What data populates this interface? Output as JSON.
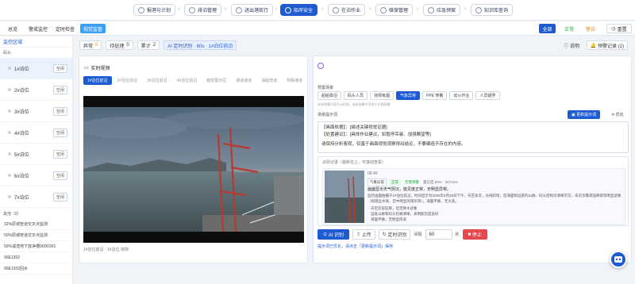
{
  "top_nav": {
    "items": [
      {
        "label": "报港与计划",
        "icon": "document-icon"
      },
      {
        "label": "排泊管理",
        "icon": "anchor-icon"
      },
      {
        "label": "进出港航行",
        "icon": "compass-icon"
      },
      {
        "label": "船岸安全",
        "icon": "shield-icon"
      },
      {
        "label": "在泊作业",
        "icon": "wrench-icon"
      },
      {
        "label": "维保管理",
        "icon": "gear-icon"
      },
      {
        "label": "应急预案",
        "icon": "alert-icon"
      },
      {
        "label": "知识库查询",
        "icon": "book-icon"
      }
    ]
  },
  "sub_nav": {
    "tabs": [
      "总览",
      "警戒监控",
      "定时检查",
      "视觉监管"
    ]
  },
  "filters": {
    "all": "全部",
    "normal": "正常",
    "warning": "警告",
    "reset": "重置"
  },
  "colors": {
    "primary": "#1c5bd1",
    "ok": "#2aa84a",
    "warn": "#e8912a",
    "danger": "#e5484d",
    "ai_chip_bg": "#e9f0ff"
  },
  "side": {
    "title": "监控区域",
    "group": "码头",
    "berths": [
      {
        "name": "1#泊位",
        "status": "空闲"
      },
      {
        "name": "2#泊位",
        "status": "空闲"
      },
      {
        "name": "3#泊位",
        "status": "空闲"
      },
      {
        "name": "4#泊位",
        "status": "空闲"
      },
      {
        "name": "5#泊位",
        "status": "空闲"
      },
      {
        "name": "6#泊位",
        "status": "空闲"
      },
      {
        "name": "7#泊位",
        "status": "空闲"
      }
    ],
    "others_label": "其他（8）",
    "others": [
      "32%原城管道交叉点监测",
      "50%原城管道交叉点监测",
      "50%减渣地下放净槽90D0301",
      "90E1302",
      "90E1302回水"
    ]
  },
  "summary": {
    "abnormal_label": "异常",
    "abnormal_value": "0",
    "pending_label": "待处理",
    "pending_value": "0",
    "total_label": "累计",
    "total_value": "2",
    "ai_chip": "AI 定时识别 · 60s · 1#泊位前沿",
    "help": "说明",
    "records": "预警记录 (2)"
  },
  "video": {
    "title": "实时视频",
    "cams": [
      "1#泊位前沿",
      "2#泊位前沿",
      "3#泊位前沿",
      "4#泊位前沿",
      "越前警示区",
      "通道通道",
      "油脂管道",
      "特殊通道"
    ],
    "caption": "1#泊位前沿 · 1#泊位 岸侧"
  },
  "right": {
    "scene_label": "预置场景",
    "scenes": [
      "船舶靠泊",
      "码头人员",
      "违规吸烟",
      "气象异常",
      "PPE 穿戴",
      "动火作业",
      "人员越界"
    ],
    "scene_hint": "仅本场景可用于AI识别，非本场景不可用于识别场景",
    "prompt_label": "场景提示词",
    "update_prompt": "更新提示词",
    "optimize": "优化",
    "prompt_lines": [
      "【画面依据】：[描述关键视觉证据]",
      "【处置建议】：[具体作业建议，如暂停吊装、加强瞭望等]",
      "请保持分析客观，仅基于画面视觉观察得出结论，不要编造不存在的内容。"
    ],
    "record_title": "识别记录（最新在上，可滚动查看）",
    "record_time": "08:40",
    "record_tag1": "气象异常",
    "record_tag2": "正常",
    "record_tag3": "无需预警",
    "record_conf": "置信度 80% · 3072ms",
    "record_summary": "画面显示天气阴沉，能见度正常，无明显异常。",
    "record_detail": "监控画面拍摄于1#泊位前沿，时间显示为2026年6月29日下午。天空多云，光线较暗，但海面和远景的山脉、码头结构均清晰可见，未见浓雾或强降雨等明显迹象（如雨丝水珠、空中明显的雨帘等）。海面平静，无大浪。",
    "record_bullets": [
      "天空云层较厚，但无降水迹象",
      "远处山脉和码头轮廓清晰，表明能见度良好",
      "海面平静，无明显风浪"
    ],
    "ai_btn": "AI 识别",
    "upload": "上传",
    "timer": "定时识别",
    "interval_label": "间隔",
    "interval_value": "60",
    "interval_unit": "秒",
    "stop": "停止",
    "footer_hint": "提示词已优化，请点击「更新提示词」保存"
  }
}
